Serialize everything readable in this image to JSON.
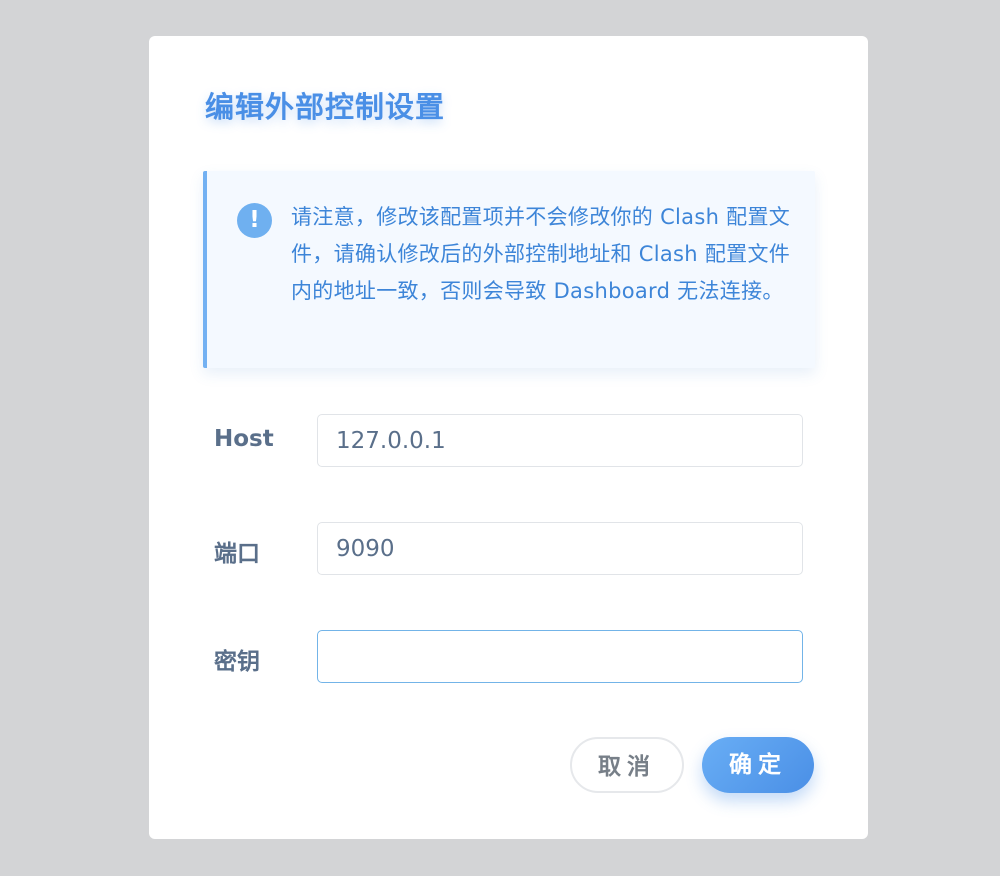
{
  "dialog": {
    "title": "编辑外部控制设置",
    "alert": {
      "icon": "exclamation-icon",
      "icon_glyph": "!",
      "message": "请注意，修改该配置项并不会修改你的 Clash 配置文件，请确认修改后的外部控制地址和 Clash 配置文件内的地址一致，否则会导致 Dashboard 无法连接。"
    },
    "fields": {
      "host": {
        "label": "Host",
        "value": "127.0.0.1"
      },
      "port": {
        "label": "端口",
        "value": "9090"
      },
      "secret": {
        "label": "密钥",
        "value": ""
      }
    },
    "buttons": {
      "cancel_label": "取消",
      "ok_label": "确定"
    }
  },
  "colors": {
    "accent": "#4a8fe6",
    "alert_bg": "#f4f9ff",
    "alert_border": "#73b1f2",
    "label": "#5a6f8a",
    "overlay": "#d3d4d6"
  }
}
